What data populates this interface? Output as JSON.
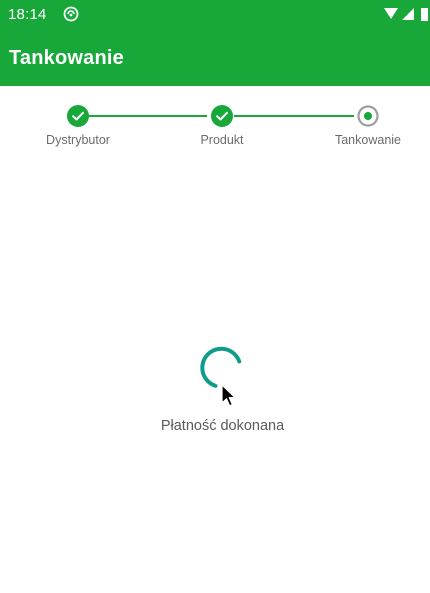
{
  "status_bar": {
    "time": "18:14",
    "icons": [
      "notification-icon",
      "wifi-icon",
      "cellular-signal-icon",
      "battery-icon"
    ]
  },
  "app_bar": {
    "title": "Tankowanie"
  },
  "stepper": {
    "steps": [
      {
        "label": "Dystrybutor",
        "state": "completed",
        "icon": "check-icon"
      },
      {
        "label": "Produkt",
        "state": "completed",
        "icon": "check-icon"
      },
      {
        "label": "Tankowanie",
        "state": "active",
        "icon": "radio-dot-icon"
      }
    ]
  },
  "content": {
    "spinner_icon": "loading-spinner-icon",
    "message": "Płatność dokonana"
  },
  "colors": {
    "primary": "#18a83a",
    "spinner": "#0f9d8a",
    "inactive_step": "#9e9e9e",
    "text_secondary": "#6b6b6b"
  }
}
